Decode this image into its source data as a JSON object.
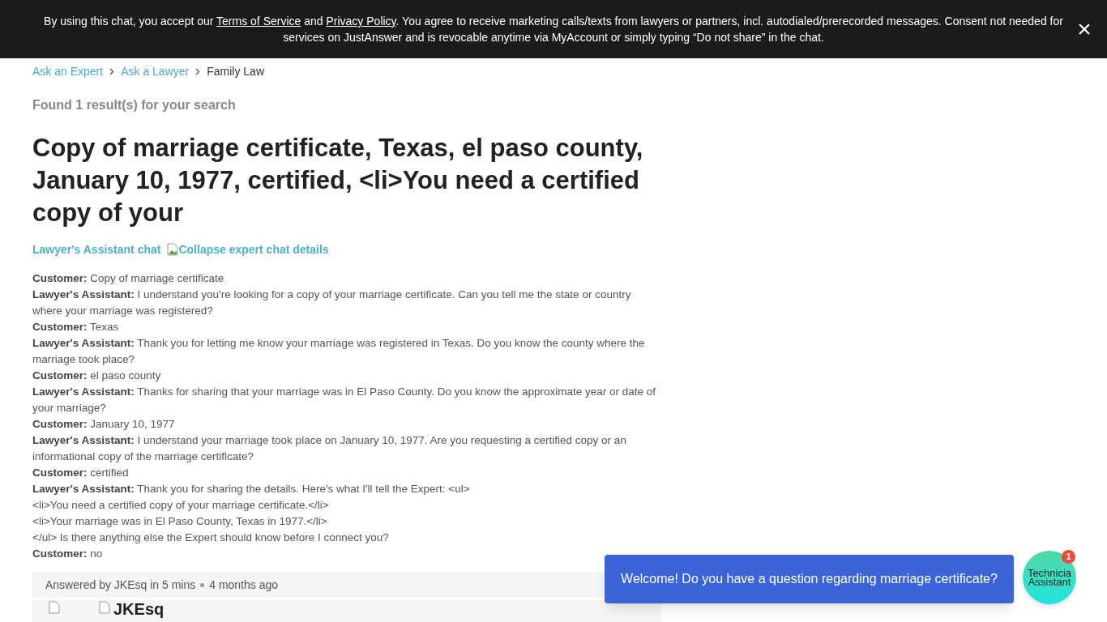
{
  "consent_banner": {
    "lead": "By using this chat, you accept our",
    "terms_link": "Terms of Service",
    "joiner": "and",
    "privacy_link": "Privacy Policy",
    "rest": ". You agree to receive marketing calls/texts from lawyers or partners, incl. autodialed/prerecorded messages. Consent not needed for services on JustAnswer and is revocable anytime via MyAccount or simply typing “Do not share” in the chat.",
    "close": "×"
  },
  "breadcrumbs": [
    {
      "label": "Ask an Expert",
      "link": true
    },
    {
      "label": "Ask a Lawyer",
      "link": true
    },
    {
      "label": "Family Law",
      "link": false
    }
  ],
  "result_count": "Found 1 result(s) for your search",
  "title": "Copy of marriage certificate, Texas, el paso county, January 10, 1977, certified, <li>You need a certified copy of your",
  "chat_toggle": {
    "label": "Lawyer's Assistant chat",
    "image_alt": "Collapse expert chat details"
  },
  "messages": [
    {
      "speaker": "Customer:",
      "text": "Copy of marriage certificate"
    },
    {
      "speaker": "Lawyer's Assistant:",
      "text": "I understand you're looking for a copy of your marriage certificate. Can you tell me the state or country where your marriage was registered?"
    },
    {
      "speaker": "Customer:",
      "text": "Texas"
    },
    {
      "speaker": "Lawyer's Assistant:",
      "text": "Thank you for letting me know your marriage was registered in Texas. Do you know the county where the marriage took place?"
    },
    {
      "speaker": "Customer:",
      "text": "el paso county"
    },
    {
      "speaker": "Lawyer's Assistant:",
      "text": "Thanks for sharing that your marriage was in El Paso County. Do you know the approximate year or date of your marriage?"
    },
    {
      "speaker": "Customer:",
      "text": "January 10, 1977"
    },
    {
      "speaker": "Lawyer's Assistant:",
      "text": "I understand your marriage took place on January 10, 1977. Are you requesting a certified copy or an informational copy of the marriage certificate?"
    },
    {
      "speaker": "Customer:",
      "text": "certified"
    },
    {
      "speaker": "Lawyer's Assistant:",
      "text": "Thank you for sharing the details. Here's what I'll tell the Expert: <ul>\n<li>You need a certified copy of your marriage certificate.</li>\n<li>Your marriage was in El Paso County, Texas in 1977.</li>\n</ul> Is there anything else the Expert should know before I connect you?"
    },
    {
      "speaker": "Customer:",
      "text": "no"
    }
  ],
  "answer": {
    "answered_by": "Answered by JKEsq in 5 mins",
    "age": "4 months ago",
    "expert_name": "JKEsq"
  },
  "chat_widget": {
    "message": "Welcome! Do you have a question regarding marriage certificate?",
    "avatar_alt": "Technicia Assistant",
    "badge": "1"
  }
}
